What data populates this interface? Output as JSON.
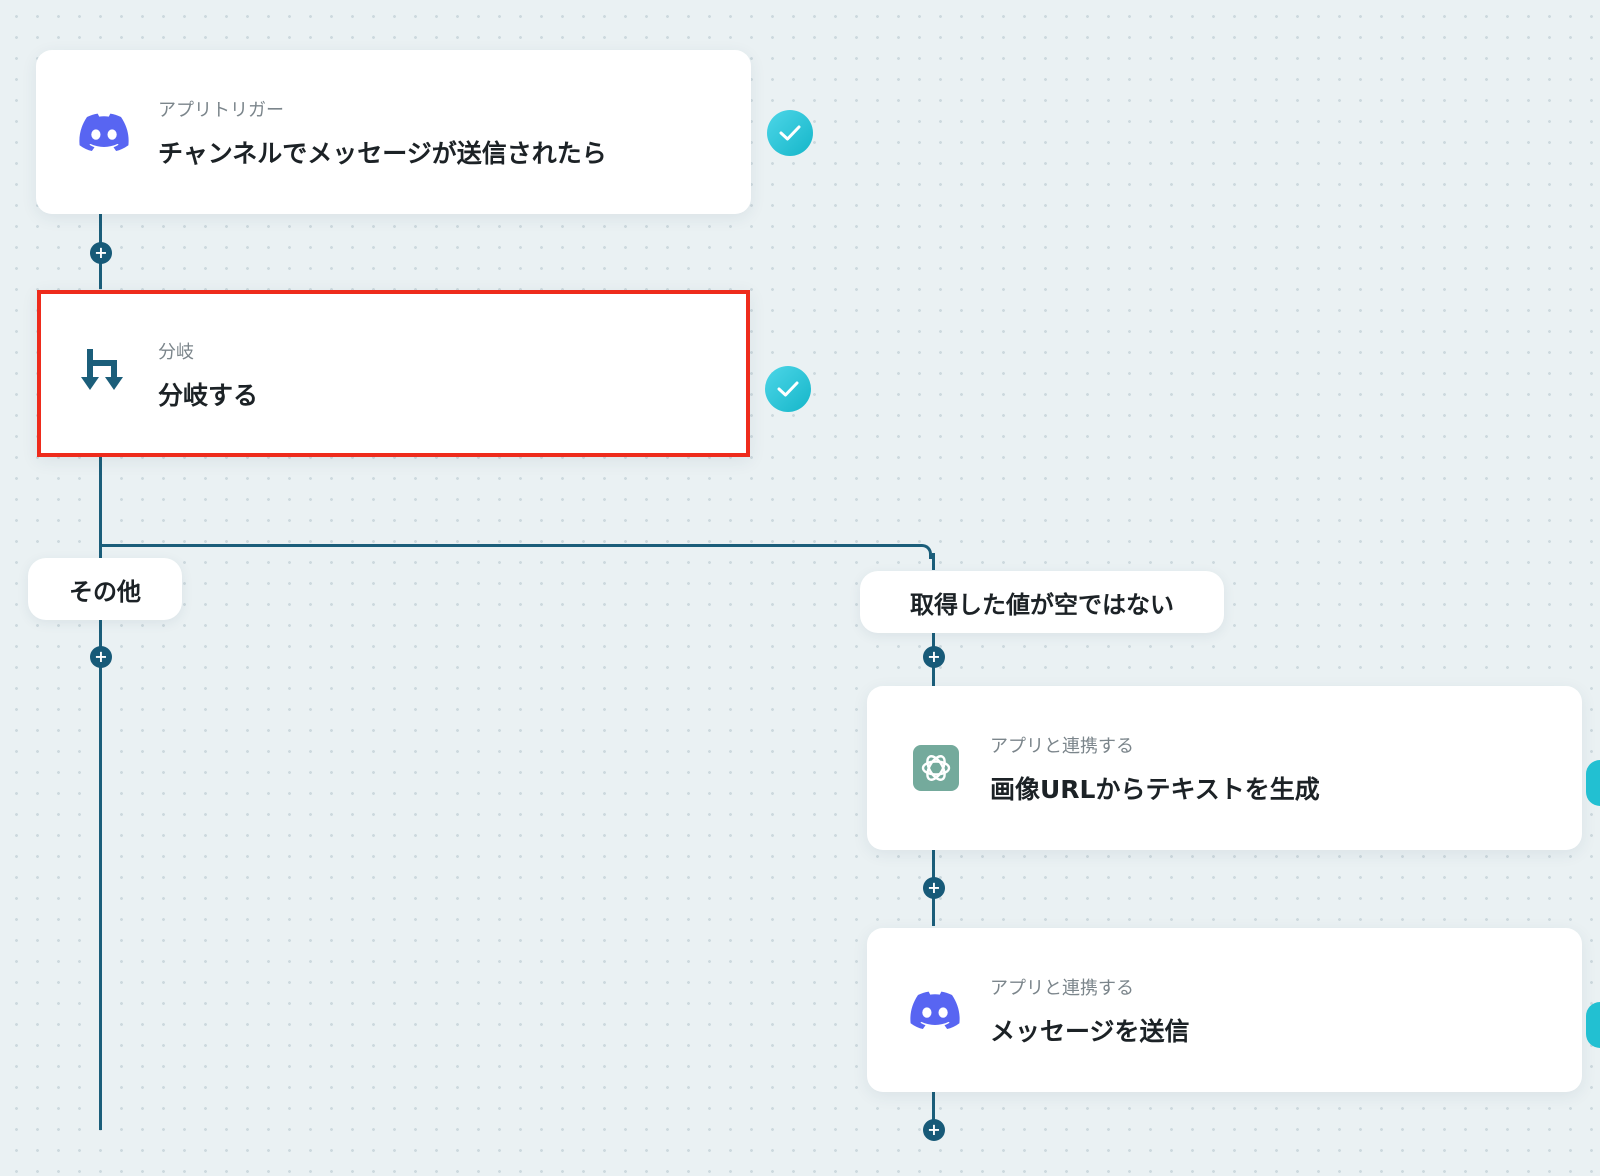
{
  "colors": {
    "connector": "#1b5e7a",
    "selected_border": "#ee2b1c",
    "check": "#15b6c9",
    "discord": "#5865f2",
    "branch_icon": "#1b5e7a",
    "openai": "#74aa9c"
  },
  "add_button_label": "+",
  "nodes": [
    {
      "kind": "アプリトリガー",
      "title": "チャンネルでメッセージが送信されたら",
      "icon": "discord-icon",
      "status": "completed"
    },
    {
      "kind": "分岐",
      "title": "分岐する",
      "icon": "branch-icon",
      "status": "completed",
      "selected": true
    },
    {
      "kind": "アプリと連携する",
      "title": "画像URLからテキストを生成",
      "icon": "openai-icon"
    },
    {
      "kind": "アプリと連携する",
      "title": "メッセージを送信",
      "icon": "discord-icon"
    }
  ],
  "branches": [
    {
      "label": "その他"
    },
    {
      "label": "取得した値が空ではない"
    }
  ]
}
